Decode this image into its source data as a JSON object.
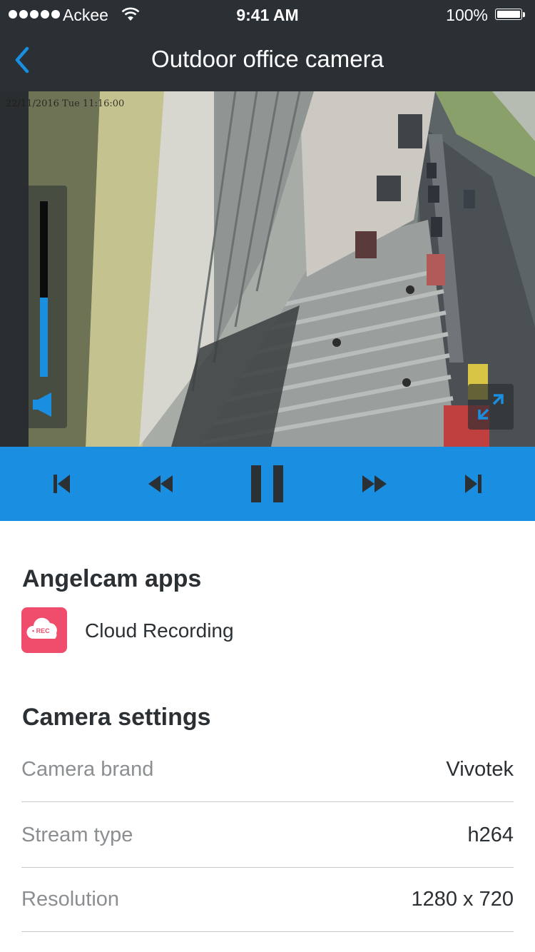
{
  "status_bar": {
    "carrier": "Ackee",
    "time": "9:41 AM",
    "battery": "100%"
  },
  "nav": {
    "back_icon": "chevron-left-icon",
    "title": "Outdoor office camera"
  },
  "video": {
    "timestamp": "22/11/2016 Tue 11:16:00",
    "volume_level": 0.45,
    "volume_icon": "speaker-icon",
    "fullscreen_icon": "expand-icon"
  },
  "playback": {
    "controls": [
      {
        "name": "skip-previous",
        "icon": "skip-previous-icon"
      },
      {
        "name": "rewind",
        "icon": "rewind-icon"
      },
      {
        "name": "pause",
        "icon": "pause-icon"
      },
      {
        "name": "fast-forward",
        "icon": "fast-forward-icon"
      },
      {
        "name": "skip-next",
        "icon": "skip-next-icon"
      }
    ]
  },
  "apps": {
    "heading": "Angelcam apps",
    "items": [
      {
        "label": "Cloud Recording",
        "icon": "cloud-rec-icon",
        "badge": "• REC"
      }
    ]
  },
  "settings": {
    "heading": "Camera settings",
    "rows": [
      {
        "label": "Camera brand",
        "value": "Vivotek"
      },
      {
        "label": "Stream type",
        "value": "h264"
      },
      {
        "label": "Resolution",
        "value": "1280 x 720"
      }
    ]
  },
  "colors": {
    "header_bg": "#2b3035",
    "accent": "#1a8ee0",
    "app_icon_bg": "#ef4d6b",
    "muted_text": "#8b8f92"
  }
}
